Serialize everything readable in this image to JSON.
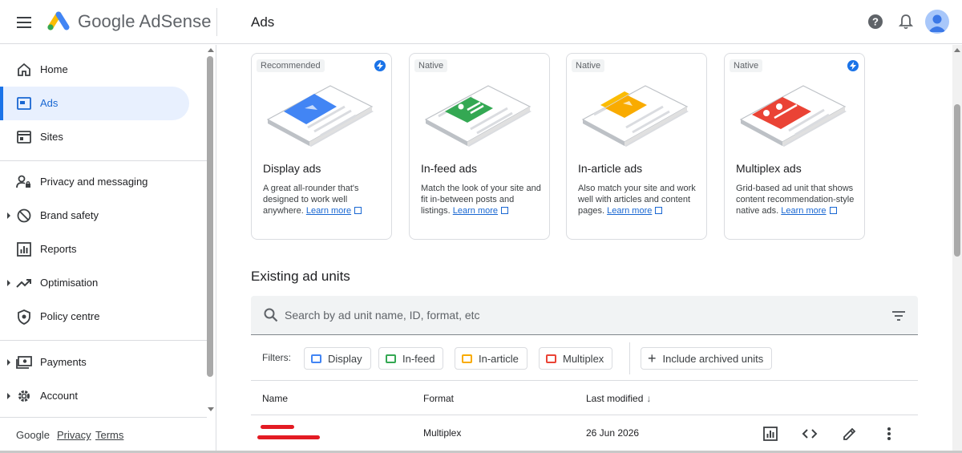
{
  "app": {
    "logo_text": "Google AdSense",
    "page_title": "Ads"
  },
  "icons": {
    "menu": "hamburger-menu-icon",
    "help": "help-circle-icon",
    "notifications": "bell-icon",
    "account": "avatar-icon"
  },
  "colors": {
    "accent": "#1a73e8",
    "active_bg": "#e8f0fe",
    "display": "#4285f4",
    "infeed": "#34a853",
    "inarticle": "#f9ab00",
    "multiplex": "#ea4335"
  },
  "sidebar": {
    "items": [
      {
        "label": "Home",
        "icon": "home-icon"
      },
      {
        "label": "Ads",
        "icon": "ads-icon",
        "active": true
      },
      {
        "label": "Sites",
        "icon": "sites-icon"
      },
      {
        "label": "Privacy and messaging",
        "icon": "privacy-icon"
      },
      {
        "label": "Brand safety",
        "icon": "block-icon",
        "expandable": true
      },
      {
        "label": "Reports",
        "icon": "reports-icon"
      },
      {
        "label": "Optimisation",
        "icon": "trending-icon",
        "expandable": true
      },
      {
        "label": "Policy centre",
        "icon": "policy-shield-icon"
      },
      {
        "label": "Payments",
        "icon": "payments-icon",
        "expandable": true
      },
      {
        "label": "Account",
        "icon": "gear-icon",
        "expandable": true
      }
    ],
    "footer": {
      "brand": "Google",
      "privacy": "Privacy",
      "terms": "Terms"
    }
  },
  "ad_types": [
    {
      "badge": "Recommended",
      "title": "Display ads",
      "description": "A great all-rounder that's designed to work well anywhere.",
      "link": "Learn more",
      "bolt": true
    },
    {
      "badge": "Native",
      "title": "In-feed ads",
      "description": "Match the look of your site and fit in-between posts and listings.",
      "link": "Learn more",
      "bolt": false
    },
    {
      "badge": "Native",
      "title": "In-article ads",
      "description": "Also match your site and work well with articles and content pages.",
      "link": "Learn more",
      "bolt": false
    },
    {
      "badge": "Native",
      "title": "Multiplex ads",
      "description": "Grid-based ad unit that shows content recommendation-style native ads.",
      "link": "Learn more",
      "bolt": true
    }
  ],
  "existing": {
    "title": "Existing ad units",
    "search_placeholder": "Search by ad unit name, ID, format, etc",
    "filters_label": "Filters:",
    "filters": [
      "Display",
      "In-feed",
      "In-article",
      "Multiplex"
    ],
    "archived": "Include archived units",
    "columns": {
      "name": "Name",
      "format": "Format",
      "modified": "Last modified",
      "sort_icon": "↓"
    },
    "rows": [
      {
        "format": "Multiplex",
        "modified": "26 Jun 2026"
      }
    ]
  }
}
